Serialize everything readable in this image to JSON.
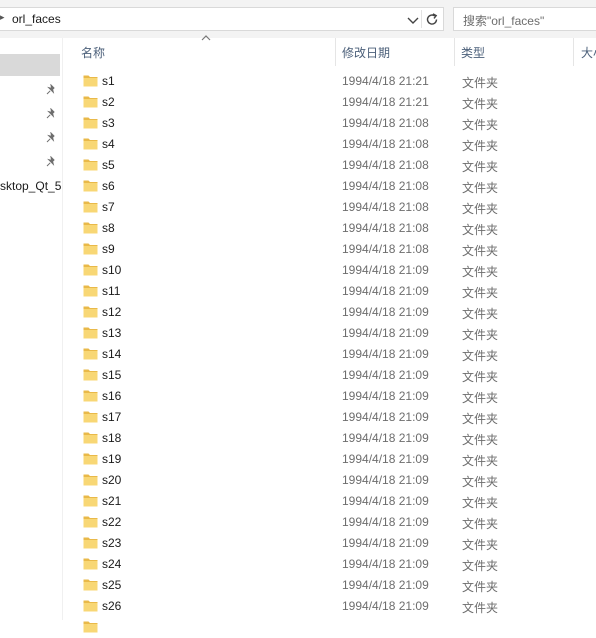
{
  "address_bar": {
    "path_segment": "orl_faces"
  },
  "search": {
    "placeholder": "搜索\"orl_faces\""
  },
  "nav_pane": {
    "truncated_item": "sktop_Qt_5"
  },
  "columns": {
    "name": "名称",
    "date": "修改日期",
    "type": "类型",
    "size": "大小"
  },
  "colors": {
    "folder": "#f8d775",
    "folder_dark": "#e9b949",
    "header_text": "#4c607a",
    "selection": "#d9d9d9"
  },
  "rows": [
    {
      "name": "s1",
      "date": "1994/4/18 21:21",
      "type": "文件夹"
    },
    {
      "name": "s2",
      "date": "1994/4/18 21:21",
      "type": "文件夹"
    },
    {
      "name": "s3",
      "date": "1994/4/18 21:08",
      "type": "文件夹"
    },
    {
      "name": "s4",
      "date": "1994/4/18 21:08",
      "type": "文件夹"
    },
    {
      "name": "s5",
      "date": "1994/4/18 21:08",
      "type": "文件夹"
    },
    {
      "name": "s6",
      "date": "1994/4/18 21:08",
      "type": "文件夹"
    },
    {
      "name": "s7",
      "date": "1994/4/18 21:08",
      "type": "文件夹"
    },
    {
      "name": "s8",
      "date": "1994/4/18 21:08",
      "type": "文件夹"
    },
    {
      "name": "s9",
      "date": "1994/4/18 21:08",
      "type": "文件夹"
    },
    {
      "name": "s10",
      "date": "1994/4/18 21:09",
      "type": "文件夹"
    },
    {
      "name": "s11",
      "date": "1994/4/18 21:09",
      "type": "文件夹"
    },
    {
      "name": "s12",
      "date": "1994/4/18 21:09",
      "type": "文件夹"
    },
    {
      "name": "s13",
      "date": "1994/4/18 21:09",
      "type": "文件夹"
    },
    {
      "name": "s14",
      "date": "1994/4/18 21:09",
      "type": "文件夹"
    },
    {
      "name": "s15",
      "date": "1994/4/18 21:09",
      "type": "文件夹"
    },
    {
      "name": "s16",
      "date": "1994/4/18 21:09",
      "type": "文件夹"
    },
    {
      "name": "s17",
      "date": "1994/4/18 21:09",
      "type": "文件夹"
    },
    {
      "name": "s18",
      "date": "1994/4/18 21:09",
      "type": "文件夹"
    },
    {
      "name": "s19",
      "date": "1994/4/18 21:09",
      "type": "文件夹"
    },
    {
      "name": "s20",
      "date": "1994/4/18 21:09",
      "type": "文件夹"
    },
    {
      "name": "s21",
      "date": "1994/4/18 21:09",
      "type": "文件夹"
    },
    {
      "name": "s22",
      "date": "1994/4/18 21:09",
      "type": "文件夹"
    },
    {
      "name": "s23",
      "date": "1994/4/18 21:09",
      "type": "文件夹"
    },
    {
      "name": "s24",
      "date": "1994/4/18 21:09",
      "type": "文件夹"
    },
    {
      "name": "s25",
      "date": "1994/4/18 21:09",
      "type": "文件夹"
    },
    {
      "name": "s26",
      "date": "1994/4/18 21:09",
      "type": "文件夹"
    }
  ]
}
